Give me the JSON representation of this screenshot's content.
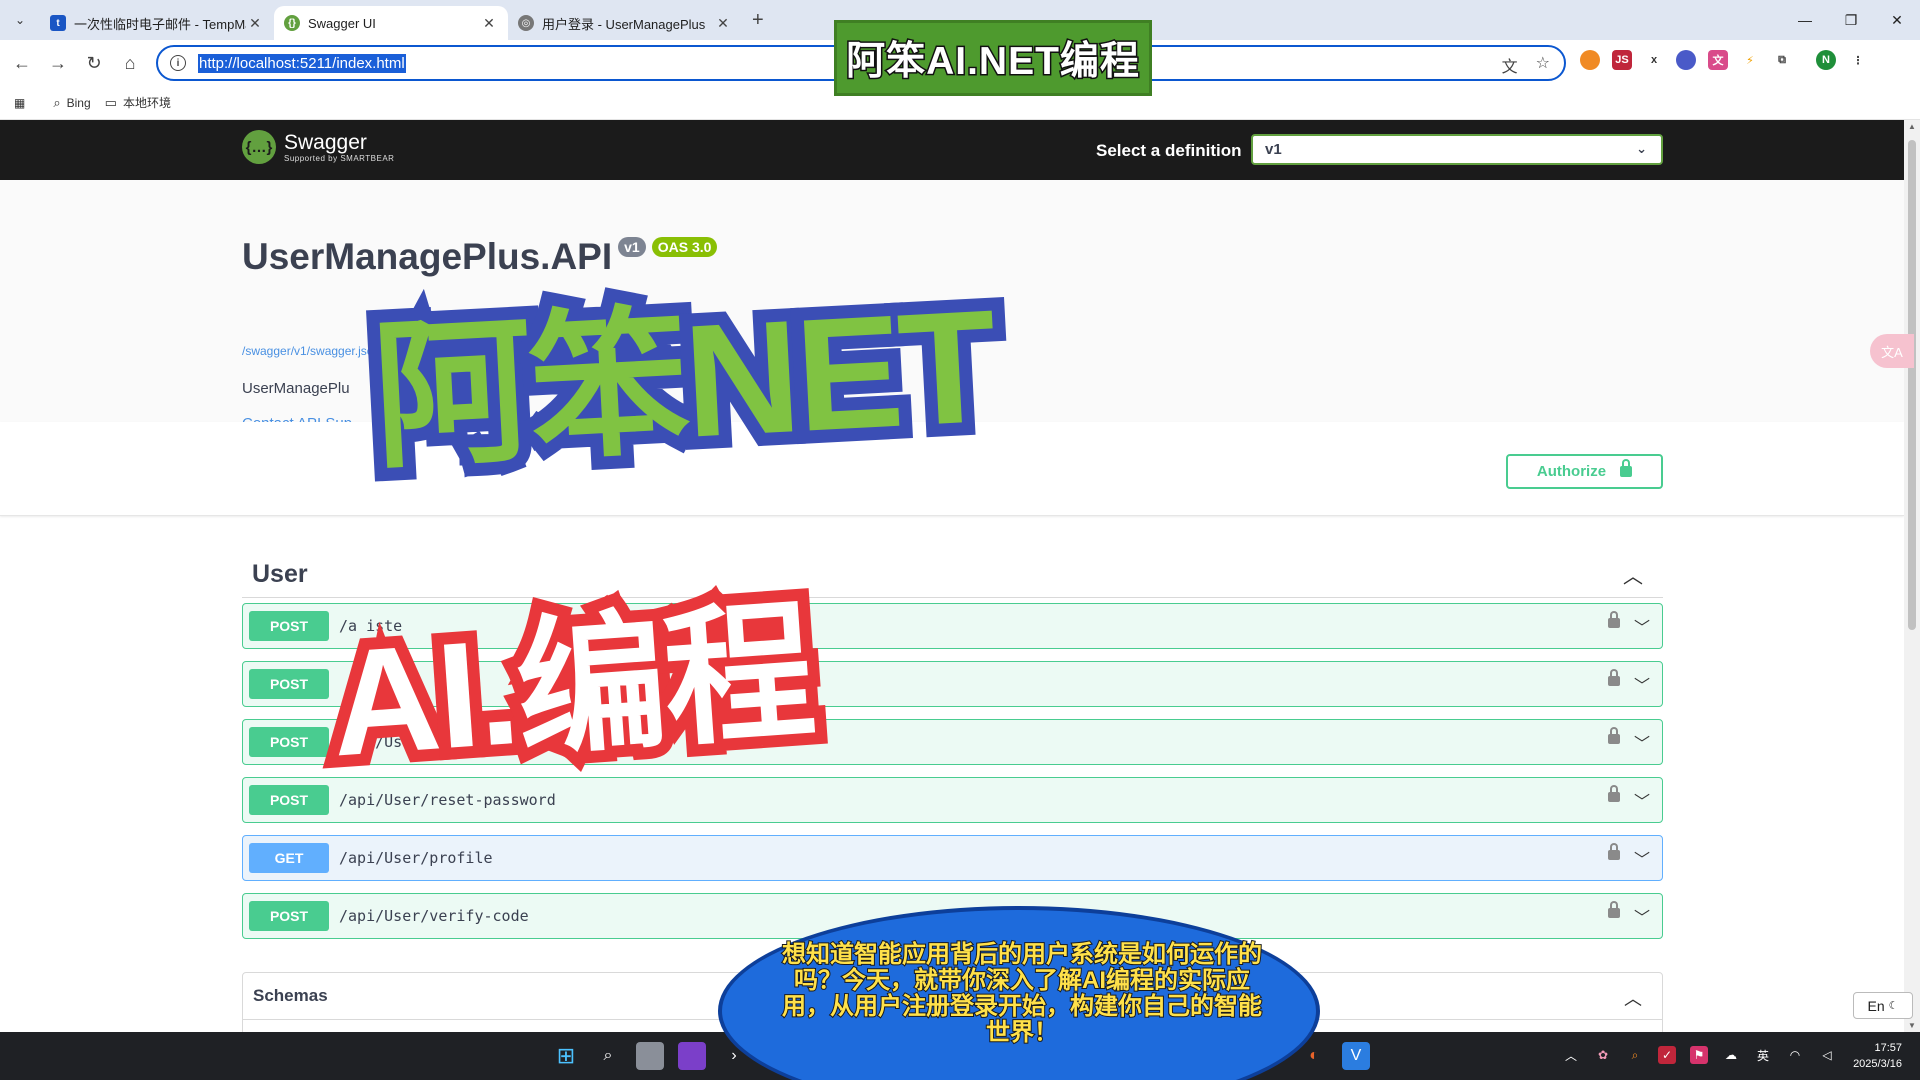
{
  "browser": {
    "tabs": [
      {
        "title": "一次性临时电子邮件 - TempMail",
        "close": "✕"
      },
      {
        "title": "Swagger UI",
        "close": "✕"
      },
      {
        "title": "用户登录 - UserManagePlus",
        "close": "✕"
      }
    ],
    "new_tab": "+",
    "url": "http://localhost:5211/index.html",
    "bookmarks": [
      {
        "label": "Bing",
        "icon": "search-icon"
      },
      {
        "label": "本地环境",
        "icon": "folder-icon"
      }
    ]
  },
  "swagger": {
    "logo_word": "Swagger",
    "logo_sub": "Supported by SMARTBEAR",
    "definition_label": "Select a definition",
    "definition_value": "v1",
    "api_title": "UserManagePlus.API",
    "version_badge": "v1",
    "oas_badge": "OAS 3.0",
    "spec_link": "/swagger/v1/swagger.json",
    "description": "UserManagePlu",
    "contact": "Contact API Sup",
    "authorize_label": "Authorize",
    "tag_name": "User",
    "operations": [
      {
        "method": "POST",
        "path": "/a                      iste",
        "type": "post"
      },
      {
        "method": "POST",
        "path": "",
        "type": "post"
      },
      {
        "method": "POST",
        "path": "/api/User/send",
        "type": "post"
      },
      {
        "method": "POST",
        "path": "/api/User/reset-password",
        "type": "post"
      },
      {
        "method": "GET",
        "path": "/api/User/profile",
        "type": "get"
      },
      {
        "method": "POST",
        "path": "/api/User/verify-code",
        "type": "post"
      }
    ],
    "schemas_label": "Schemas"
  },
  "overlay": {
    "banner": "阿笨AI.NET编程",
    "big_text_1": "阿笨NET",
    "big_text_2": "AI.编程",
    "bubble_text": "想知道智能应用背后的用户系统是如何运作的吗？今天，就带你深入了解AI编程的实际应用，从用户注册登录开始，构建你自己的智能世界！"
  },
  "system": {
    "ime": "En",
    "ime_lang": "英",
    "time": "17:57",
    "date": "2025/3/16"
  },
  "colors": {
    "post": "#49cc90",
    "get": "#61affe",
    "swagger_green": "#62a03f"
  }
}
